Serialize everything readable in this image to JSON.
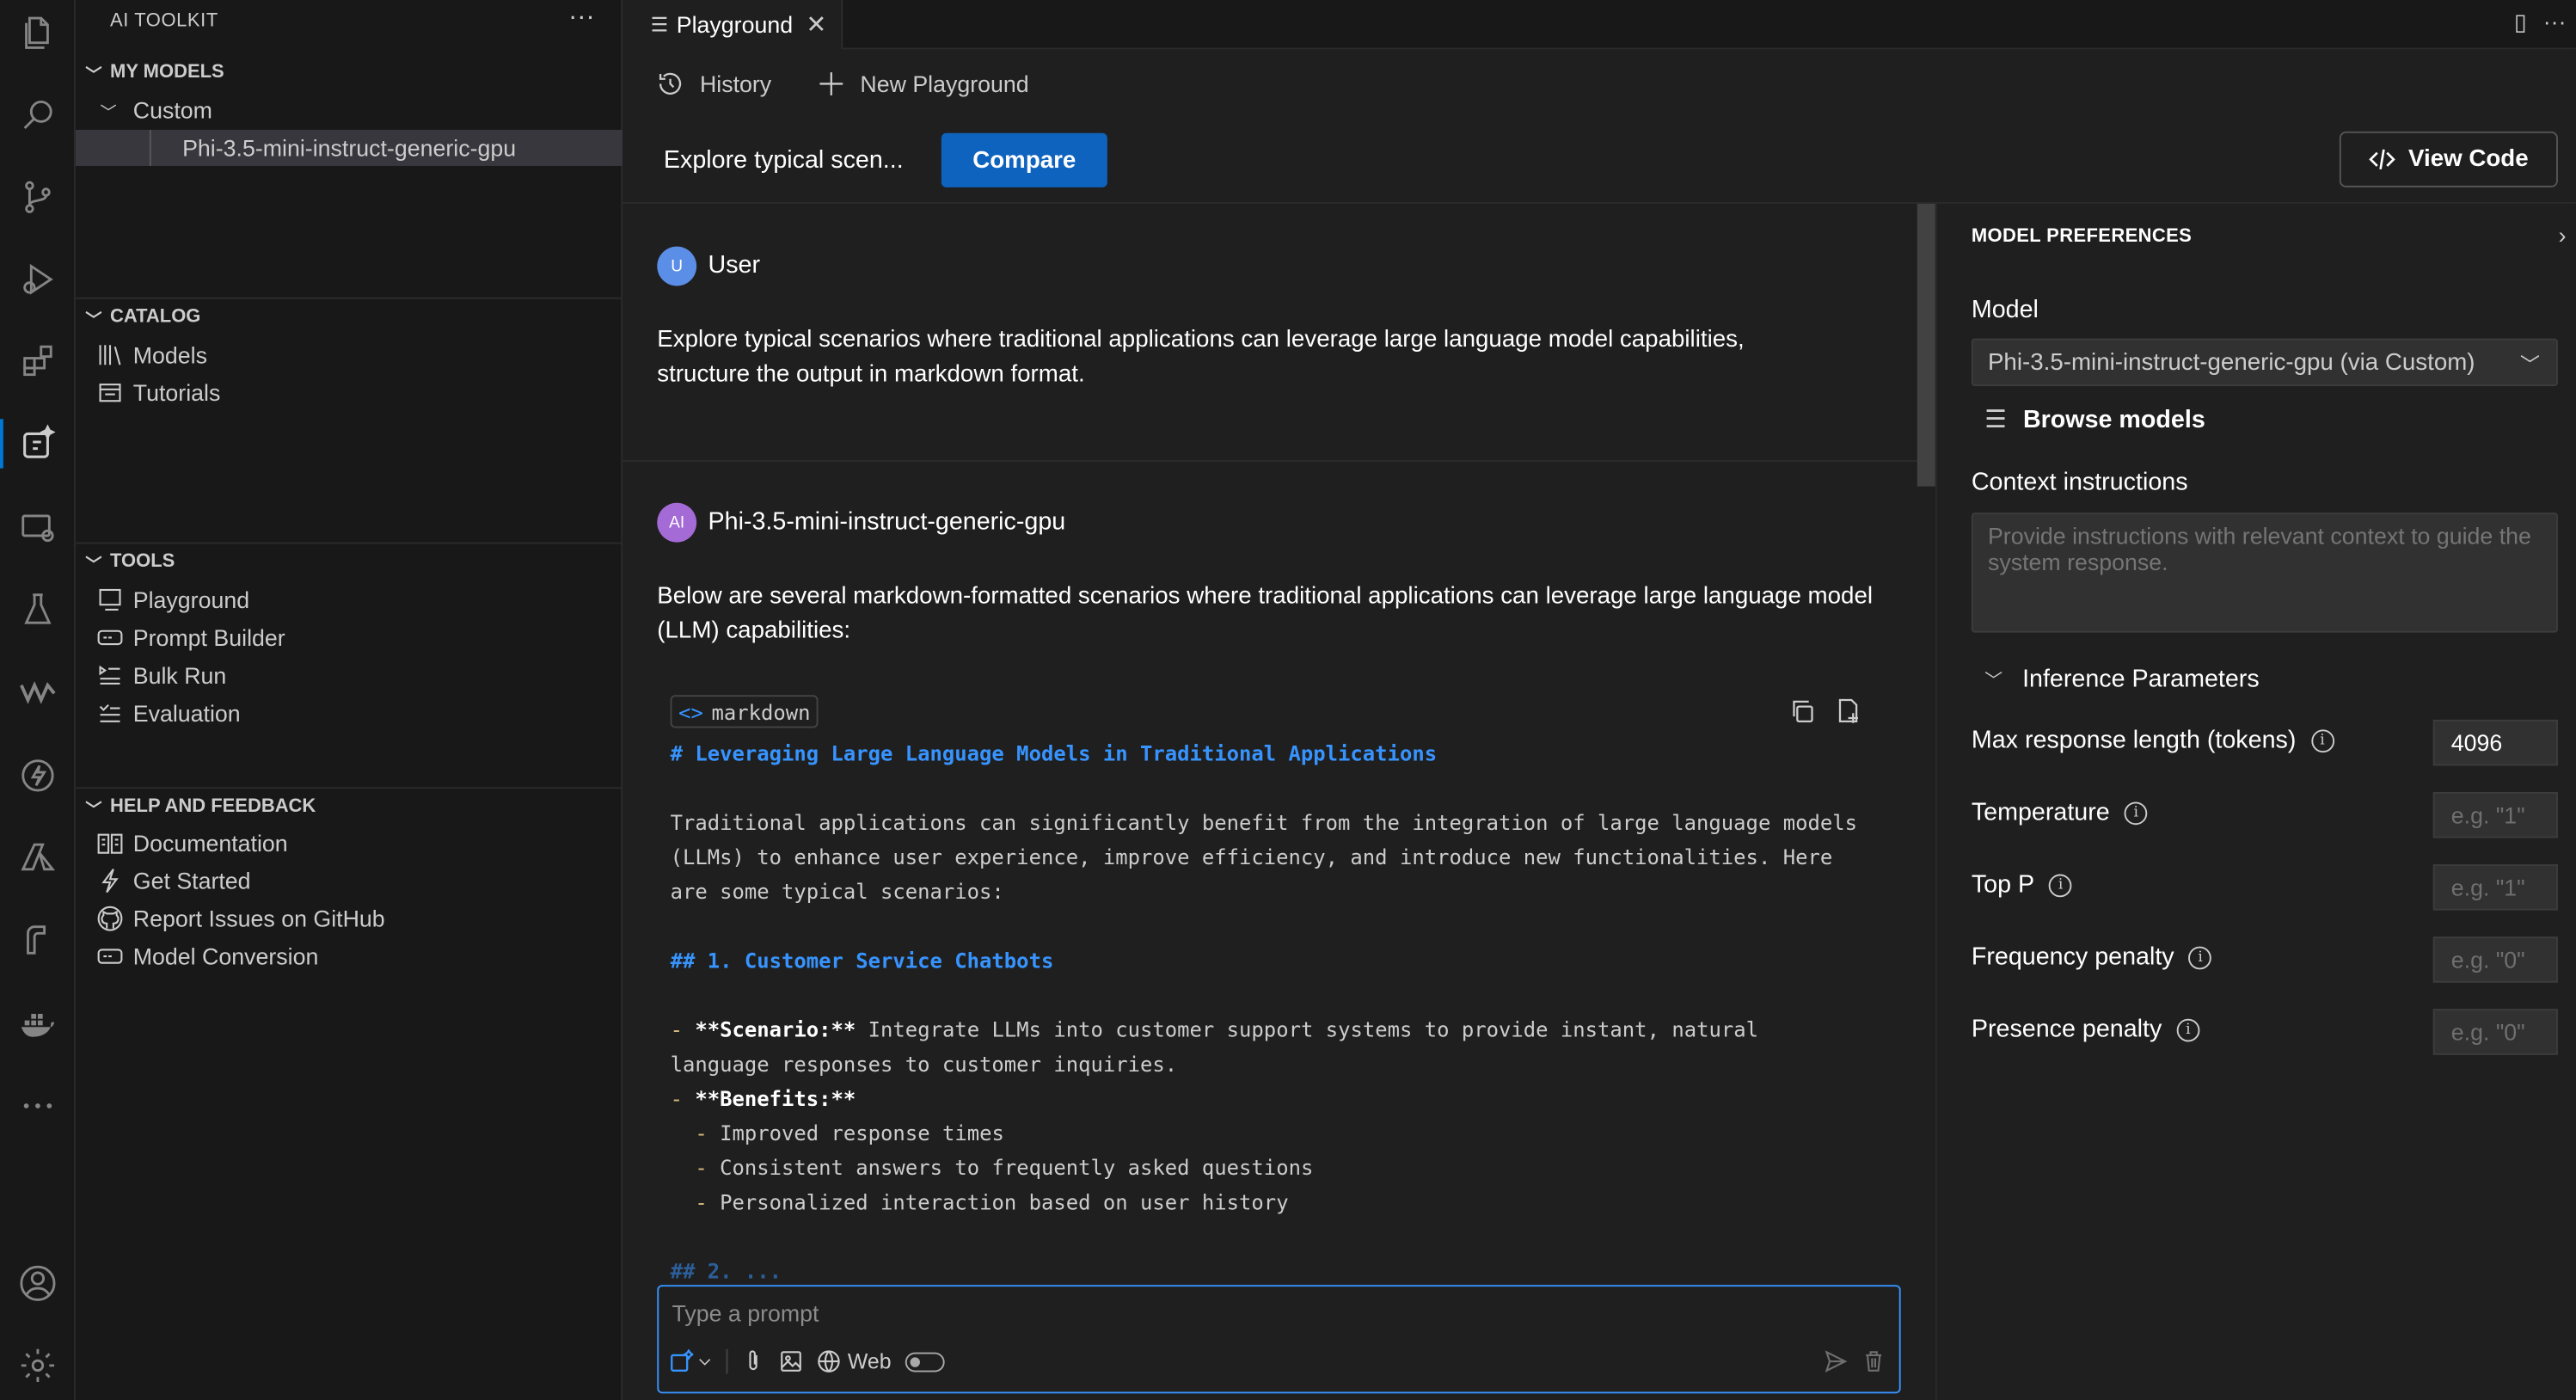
{
  "sidebar": {
    "title": "AI TOOLKIT",
    "more": "···",
    "sections": {
      "my_models": {
        "header": "MY MODELS",
        "group": "Custom",
        "selected_model": "Phi-3.5-mini-instruct-generic-gpu"
      },
      "catalog": {
        "header": "CATALOG",
        "items": [
          {
            "label": "Models",
            "icon": "library-icon"
          },
          {
            "label": "Tutorials",
            "icon": "tutorial-icon"
          }
        ]
      },
      "tools": {
        "header": "TOOLS",
        "items": [
          {
            "label": "Playground",
            "icon": "playground-icon"
          },
          {
            "label": "Prompt Builder",
            "icon": "prompt-builder-icon"
          },
          {
            "label": "Bulk Run",
            "icon": "bulk-run-icon"
          },
          {
            "label": "Evaluation",
            "icon": "evaluation-icon"
          }
        ]
      },
      "help": {
        "header": "HELP AND FEEDBACK",
        "items": [
          {
            "label": "Documentation",
            "icon": "book-icon"
          },
          {
            "label": "Get Started",
            "icon": "lightning-icon"
          },
          {
            "label": "Report Issues on GitHub",
            "icon": "github-icon"
          },
          {
            "label": "Model Conversion",
            "icon": "convert-icon"
          }
        ]
      }
    }
  },
  "editor": {
    "tab": {
      "label": "Playground",
      "close": "✕"
    },
    "toolbar": {
      "history": "History",
      "new_playground": "New Playground"
    },
    "scenario_title": "Explore typical scen...",
    "compare_label": "Compare",
    "view_code_label": "View Code"
  },
  "chat": {
    "user": {
      "avatar": "U",
      "name": "User",
      "text": "Explore typical scenarios where traditional applications can leverage large language model capabilities, structure the output in markdown format."
    },
    "assistant": {
      "avatar": "AI",
      "name": "Phi-3.5-mini-instruct-generic-gpu",
      "intro": "Below are several markdown-formatted scenarios where traditional applications can leverage large language model (LLM) capabilities:",
      "code_lang": "markdown",
      "code_lines": {
        "h1": "# Leveraging Large Language Models in Traditional Applications",
        "p1": "Traditional applications can significantly benefit from the integration of large language models",
        "p2": "(LLMs) to enhance user experience, improve efficiency, and introduce new functionalities. Here",
        "p3": "are some typical scenarios:",
        "h2": "## 1. Customer Service Chatbots",
        "s_bullet": "- ",
        "s_bold": "**Scenario:**",
        "s_text": " Integrate LLMs into customer support systems to provide instant, natural",
        "s_cont": "language responses to customer inquiries.",
        "b_bold": "**Benefits:**",
        "ben1": "Improved response times",
        "ben2": "Consistent answers to frequently asked questions",
        "ben3": "Personalized interaction based on user history",
        "cut": "## 2. ..."
      }
    },
    "prompt": {
      "placeholder": "Type a prompt",
      "web_label": "Web"
    }
  },
  "preferences": {
    "title": "MODEL PREFERENCES",
    "model_label": "Model",
    "model_value": "Phi-3.5-mini-instruct-generic-gpu (via Custom)",
    "browse_label": "Browse models",
    "context_label": "Context instructions",
    "context_placeholder": "Provide instructions with relevant context to guide the system response.",
    "inference_label": "Inference Parameters",
    "params": [
      {
        "label": "Max response length (tokens)",
        "value": "4096",
        "placeholder": ""
      },
      {
        "label": "Temperature",
        "value": "",
        "placeholder": "e.g. \"1\""
      },
      {
        "label": "Top P",
        "value": "",
        "placeholder": "e.g. \"1\""
      },
      {
        "label": "Frequency penalty",
        "value": "",
        "placeholder": "e.g. \"0\""
      },
      {
        "label": "Presence penalty",
        "value": "",
        "placeholder": "e.g. \"0\""
      }
    ]
  },
  "colors": {
    "accent": "#0e63be",
    "link_blue": "#3794ff",
    "user_avatar": "#5b8ee6",
    "ai_avatar": "#a46ad6",
    "markdown_bullet": "#d7ba7d"
  }
}
